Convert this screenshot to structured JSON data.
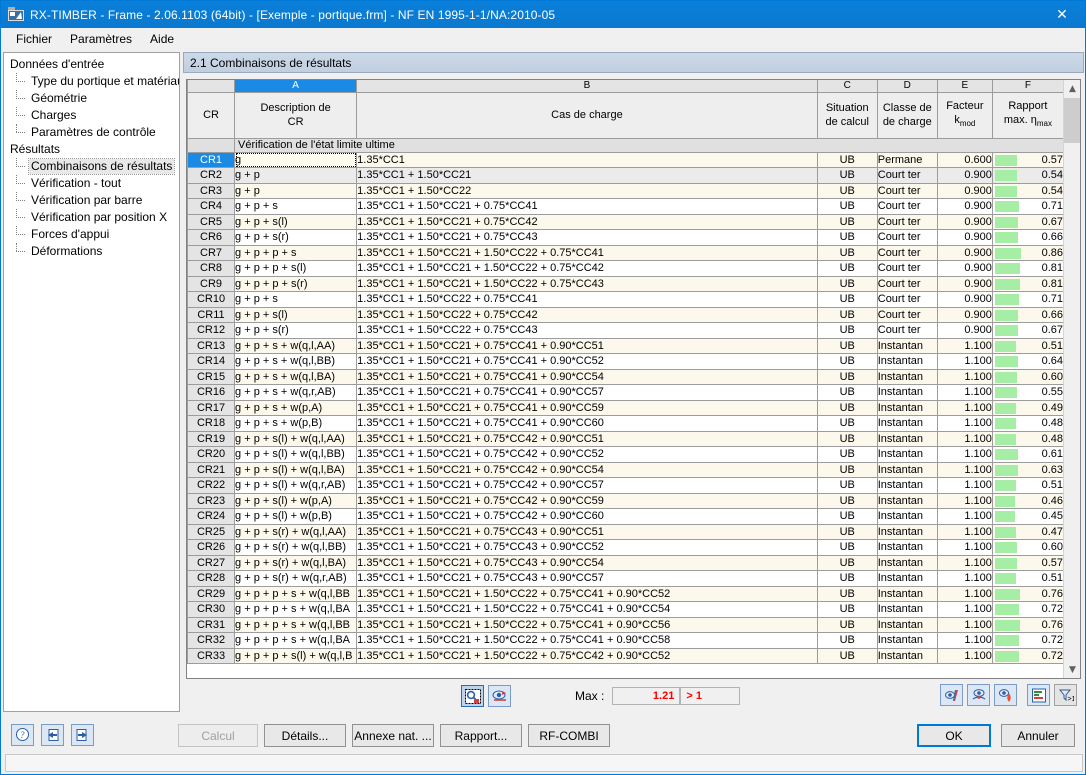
{
  "window": {
    "title": "RX-TIMBER - Frame - 2.06.1103 (64bit) - [Exemple - portique.frm] - NF EN 1995-1-1/NA:2010-05",
    "icon": "app-icon",
    "close_label": "✕"
  },
  "menubar": {
    "items": [
      {
        "label": "Fichier"
      },
      {
        "label": "Paramètres"
      },
      {
        "label": "Aide"
      }
    ]
  },
  "sidebar": {
    "groups": [
      {
        "label": "Données d'entrée",
        "items": [
          {
            "label": "Type du portique et matériau",
            "selected": false
          },
          {
            "label": "Géométrie",
            "selected": false
          },
          {
            "label": "Charges",
            "selected": false
          },
          {
            "label": "Paramètres de contrôle",
            "selected": false
          }
        ]
      },
      {
        "label": "Résultats",
        "items": [
          {
            "label": "Combinaisons de résultats",
            "selected": true
          },
          {
            "label": "Vérification - tout",
            "selected": false
          },
          {
            "label": "Vérification par barre",
            "selected": false
          },
          {
            "label": "Vérification par position X",
            "selected": false
          },
          {
            "label": "Forces d'appui",
            "selected": false
          },
          {
            "label": "Déformations",
            "selected": false
          }
        ]
      }
    ]
  },
  "section": {
    "title": "2.1 Combinaisons de résultats"
  },
  "grid": {
    "column_letters": [
      "",
      "A",
      "B",
      "C",
      "D",
      "E",
      "F"
    ],
    "selected_column_letter": "A",
    "headers": [
      {
        "line1": "CR",
        "line2": ""
      },
      {
        "line1": "Description de",
        "line2": "CR"
      },
      {
        "line1": "",
        "line2": "Cas de charge"
      },
      {
        "line1": "Situation",
        "line2": "de calcul"
      },
      {
        "line1": "Classe de",
        "line2": "de charge"
      },
      {
        "line1": "Facteur",
        "line2": "k",
        "sub2": "mod"
      },
      {
        "line1": "Rapport",
        "line2": "max. η",
        "sub2": "max"
      }
    ],
    "group_row_label": "Vérification de l'état limite ultime",
    "selected_row": "CR1",
    "rows": [
      {
        "cr": "CR1",
        "desc": "g",
        "load": "1.35*CC1",
        "situation": "UB",
        "classe": "Permane",
        "kmod": "0.600",
        "ratio": "0.57"
      },
      {
        "cr": "CR2",
        "desc": "g + p",
        "load": "1.35*CC1 + 1.50*CC21",
        "situation": "UB",
        "classe": "Court ter",
        "kmod": "0.900",
        "ratio": "0.54"
      },
      {
        "cr": "CR3",
        "desc": "g + p",
        "load": "1.35*CC1 + 1.50*CC22",
        "situation": "UB",
        "classe": "Court ter",
        "kmod": "0.900",
        "ratio": "0.54"
      },
      {
        "cr": "CR4",
        "desc": "g + p + s",
        "load": "1.35*CC1 + 1.50*CC21 + 0.75*CC41",
        "situation": "UB",
        "classe": "Court ter",
        "kmod": "0.900",
        "ratio": "0.71"
      },
      {
        "cr": "CR5",
        "desc": "g + p + s(l)",
        "load": "1.35*CC1 + 1.50*CC21 + 0.75*CC42",
        "situation": "UB",
        "classe": "Court ter",
        "kmod": "0.900",
        "ratio": "0.67"
      },
      {
        "cr": "CR6",
        "desc": "g + p + s(r)",
        "load": "1.35*CC1 + 1.50*CC21 + 0.75*CC43",
        "situation": "UB",
        "classe": "Court ter",
        "kmod": "0.900",
        "ratio": "0.66"
      },
      {
        "cr": "CR7",
        "desc": "g + p + p + s",
        "load": "1.35*CC1 + 1.50*CC21 + 1.50*CC22 + 0.75*CC41",
        "situation": "UB",
        "classe": "Court ter",
        "kmod": "0.900",
        "ratio": "0.86"
      },
      {
        "cr": "CR8",
        "desc": "g + p + p + s(l)",
        "load": "1.35*CC1 + 1.50*CC21 + 1.50*CC22 + 0.75*CC42",
        "situation": "UB",
        "classe": "Court ter",
        "kmod": "0.900",
        "ratio": "0.81"
      },
      {
        "cr": "CR9",
        "desc": "g + p + p + s(r)",
        "load": "1.35*CC1 + 1.50*CC21 + 1.50*CC22 + 0.75*CC43",
        "situation": "UB",
        "classe": "Court ter",
        "kmod": "0.900",
        "ratio": "0.81"
      },
      {
        "cr": "CR10",
        "desc": "g + p + s",
        "load": "1.35*CC1 + 1.50*CC22 + 0.75*CC41",
        "situation": "UB",
        "classe": "Court ter",
        "kmod": "0.900",
        "ratio": "0.71"
      },
      {
        "cr": "CR11",
        "desc": "g + p + s(l)",
        "load": "1.35*CC1 + 1.50*CC22 + 0.75*CC42",
        "situation": "UB",
        "classe": "Court ter",
        "kmod": "0.900",
        "ratio": "0.66"
      },
      {
        "cr": "CR12",
        "desc": "g + p + s(r)",
        "load": "1.35*CC1 + 1.50*CC22 + 0.75*CC43",
        "situation": "UB",
        "classe": "Court ter",
        "kmod": "0.900",
        "ratio": "0.67"
      },
      {
        "cr": "CR13",
        "desc": "g + p + s + w(q,l,AA)",
        "load": "1.35*CC1 + 1.50*CC21 + 0.75*CC41 + 0.90*CC51",
        "situation": "UB",
        "classe": "Instantan",
        "kmod": "1.100",
        "ratio": "0.51"
      },
      {
        "cr": "CR14",
        "desc": "g + p + s + w(q,l,BB)",
        "load": "1.35*CC1 + 1.50*CC21 + 0.75*CC41 + 0.90*CC52",
        "situation": "UB",
        "classe": "Instantan",
        "kmod": "1.100",
        "ratio": "0.64"
      },
      {
        "cr": "CR15",
        "desc": "g + p + s + w(q,l,BA)",
        "load": "1.35*CC1 + 1.50*CC21 + 0.75*CC41 + 0.90*CC54",
        "situation": "UB",
        "classe": "Instantan",
        "kmod": "1.100",
        "ratio": "0.60"
      },
      {
        "cr": "CR16",
        "desc": "g + p + s + w(q,r,AB)",
        "load": "1.35*CC1 + 1.50*CC21 + 0.75*CC41 + 0.90*CC57",
        "situation": "UB",
        "classe": "Instantan",
        "kmod": "1.100",
        "ratio": "0.55"
      },
      {
        "cr": "CR17",
        "desc": "g + p + s + w(p,A)",
        "load": "1.35*CC1 + 1.50*CC21 + 0.75*CC41 + 0.90*CC59",
        "situation": "UB",
        "classe": "Instantan",
        "kmod": "1.100",
        "ratio": "0.49"
      },
      {
        "cr": "CR18",
        "desc": "g + p + s + w(p,B)",
        "load": "1.35*CC1 + 1.50*CC21 + 0.75*CC41 + 0.90*CC60",
        "situation": "UB",
        "classe": "Instantan",
        "kmod": "1.100",
        "ratio": "0.48"
      },
      {
        "cr": "CR19",
        "desc": "g + p + s(l) + w(q,l,AA)",
        "load": "1.35*CC1 + 1.50*CC21 + 0.75*CC42 + 0.90*CC51",
        "situation": "UB",
        "classe": "Instantan",
        "kmod": "1.100",
        "ratio": "0.48"
      },
      {
        "cr": "CR20",
        "desc": "g + p + s(l) + w(q,l,BB)",
        "load": "1.35*CC1 + 1.50*CC21 + 0.75*CC42 + 0.90*CC52",
        "situation": "UB",
        "classe": "Instantan",
        "kmod": "1.100",
        "ratio": "0.61"
      },
      {
        "cr": "CR21",
        "desc": "g + p + s(l) + w(q,l,BA)",
        "load": "1.35*CC1 + 1.50*CC21 + 0.75*CC42 + 0.90*CC54",
        "situation": "UB",
        "classe": "Instantan",
        "kmod": "1.100",
        "ratio": "0.63"
      },
      {
        "cr": "CR22",
        "desc": "g + p + s(l) + w(q,r,AB)",
        "load": "1.35*CC1 + 1.50*CC21 + 0.75*CC42 + 0.90*CC57",
        "situation": "UB",
        "classe": "Instantan",
        "kmod": "1.100",
        "ratio": "0.51"
      },
      {
        "cr": "CR23",
        "desc": "g + p + s(l) + w(p,A)",
        "load": "1.35*CC1 + 1.50*CC21 + 0.75*CC42 + 0.90*CC59",
        "situation": "UB",
        "classe": "Instantan",
        "kmod": "1.100",
        "ratio": "0.46"
      },
      {
        "cr": "CR24",
        "desc": "g + p + s(l) + w(p,B)",
        "load": "1.35*CC1 + 1.50*CC21 + 0.75*CC42 + 0.90*CC60",
        "situation": "UB",
        "classe": "Instantan",
        "kmod": "1.100",
        "ratio": "0.45"
      },
      {
        "cr": "CR25",
        "desc": "g + p + s(r) + w(q,l,AA)",
        "load": "1.35*CC1 + 1.50*CC21 + 0.75*CC43 + 0.90*CC51",
        "situation": "UB",
        "classe": "Instantan",
        "kmod": "1.100",
        "ratio": "0.47"
      },
      {
        "cr": "CR26",
        "desc": "g + p + s(r) + w(q,l,BB)",
        "load": "1.35*CC1 + 1.50*CC21 + 0.75*CC43 + 0.90*CC52",
        "situation": "UB",
        "classe": "Instantan",
        "kmod": "1.100",
        "ratio": "0.60"
      },
      {
        "cr": "CR27",
        "desc": "g + p + s(r) + w(q,l,BA)",
        "load": "1.35*CC1 + 1.50*CC21 + 0.75*CC43 + 0.90*CC54",
        "situation": "UB",
        "classe": "Instantan",
        "kmod": "1.100",
        "ratio": "0.57"
      },
      {
        "cr": "CR28",
        "desc": "g + p + s(r) + w(q,r,AB)",
        "load": "1.35*CC1 + 1.50*CC21 + 0.75*CC43 + 0.90*CC57",
        "situation": "UB",
        "classe": "Instantan",
        "kmod": "1.100",
        "ratio": "0.51"
      },
      {
        "cr": "CR29",
        "desc": "g + p + p + s + w(q,l,BB",
        "load": "1.35*CC1 + 1.50*CC21 + 1.50*CC22 + 0.75*CC41 + 0.90*CC52",
        "situation": "UB",
        "classe": "Instantan",
        "kmod": "1.100",
        "ratio": "0.76"
      },
      {
        "cr": "CR30",
        "desc": "g + p + p + s + w(q,l,BA",
        "load": "1.35*CC1 + 1.50*CC21 + 1.50*CC22 + 0.75*CC41 + 0.90*CC54",
        "situation": "UB",
        "classe": "Instantan",
        "kmod": "1.100",
        "ratio": "0.72"
      },
      {
        "cr": "CR31",
        "desc": "g + p + p + s + w(q,l,BB",
        "load": "1.35*CC1 + 1.50*CC21 + 1.50*CC22 + 0.75*CC41 + 0.90*CC56",
        "situation": "UB",
        "classe": "Instantan",
        "kmod": "1.100",
        "ratio": "0.76"
      },
      {
        "cr": "CR32",
        "desc": "g + p + p + s + w(q,l,BA",
        "load": "1.35*CC1 + 1.50*CC21 + 1.50*CC22 + 0.75*CC41 + 0.90*CC58",
        "situation": "UB",
        "classe": "Instantan",
        "kmod": "1.100",
        "ratio": "0.72"
      },
      {
        "cr": "CR33",
        "desc": "g + p + p + s(l) + w(q,l,B",
        "load": "1.35*CC1 + 1.50*CC21 + 1.50*CC22 + 0.75*CC42 + 0.90*CC52",
        "situation": "UB",
        "classe": "Instantan",
        "kmod": "1.100",
        "ratio": "0.72"
      }
    ]
  },
  "grid_toolbar": {
    "left_icons": [
      {
        "name": "select-region-icon",
        "active": true
      },
      {
        "name": "view-graphic-icon",
        "active": false
      }
    ],
    "max_label": "Max :",
    "max_value": "1.21",
    "max_flag": "> 1",
    "right_icons": [
      {
        "name": "result-diagram-icon"
      },
      {
        "name": "deformation-view-icon"
      },
      {
        "name": "critical-value-icon"
      },
      {
        "name": "chart-bars-icon"
      },
      {
        "name": "filter-gt1-icon"
      }
    ]
  },
  "bottom": {
    "icon_buttons": [
      {
        "name": "help-icon"
      },
      {
        "name": "previous-page-icon"
      },
      {
        "name": "next-page-icon"
      }
    ],
    "buttons": [
      {
        "label": "Calcul",
        "disabled": true
      },
      {
        "label": "Détails...",
        "disabled": false
      },
      {
        "label": "Annexe nat. ...",
        "disabled": false
      },
      {
        "label": "Rapport...",
        "disabled": false
      },
      {
        "label": "RF-COMBI",
        "disabled": false
      }
    ],
    "ok_label": "OK",
    "cancel_label": "Annuler"
  },
  "colors": {
    "title_bar": "#0a7bd4",
    "accent": "#1a8ae5",
    "ratio_bar": "#a6eda6",
    "alert_text": "#ff0000",
    "row_cream": "#fdf8ec",
    "row_gray": "#ebebeb"
  }
}
